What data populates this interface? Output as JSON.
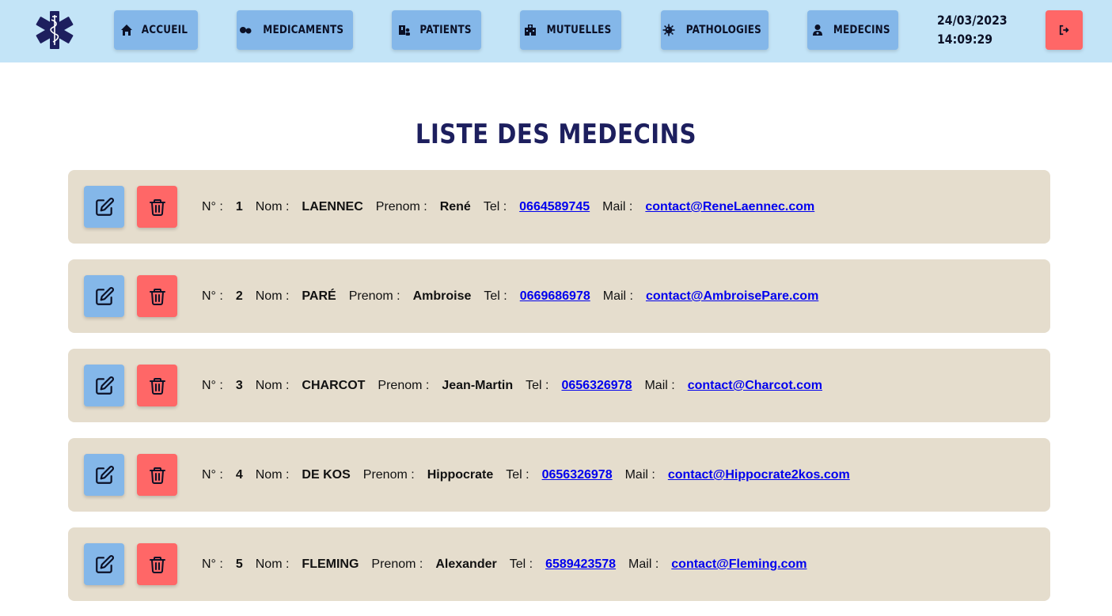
{
  "colors": {
    "topbar": "#c3e4f7",
    "nav_button": "#84b7e9",
    "danger": "#ff6767",
    "row_bg": "#e5ddcd",
    "title": "#1d1f5e",
    "link": "#0000ee"
  },
  "header": {
    "logo_icon": "star-of-life-caduceus-icon",
    "nav": [
      {
        "label": "ACCUEIL",
        "icon": "home-icon"
      },
      {
        "label": "MEDICAMENTS",
        "icon": "pills-icon"
      },
      {
        "label": "PATIENTS",
        "icon": "hospital-user-icon"
      },
      {
        "label": "MUTUELLES",
        "icon": "hospital-icon"
      },
      {
        "label": "PATHOLOGIES",
        "icon": "virus-icon"
      },
      {
        "label": "MEDECINS",
        "icon": "user-doctor-icon"
      }
    ],
    "date": "24/03/2023",
    "time": "14:09:29",
    "logout_icon": "sign-out-icon"
  },
  "main": {
    "title": "LISTE DES MEDECINS",
    "labels": {
      "num": "N° :",
      "nom": "Nom :",
      "prenom": "Prenom :",
      "tel": "Tel :",
      "mail": "Mail :"
    },
    "doctors": [
      {
        "num": "1",
        "nom": "LAENNEC",
        "prenom": "René",
        "tel": "0664589745",
        "mail": "contact@ReneLaennec.com"
      },
      {
        "num": "2",
        "nom": "PARÉ",
        "prenom": "Ambroise",
        "tel": "0669686978",
        "mail": "contact@AmbroisePare.com"
      },
      {
        "num": "3",
        "nom": "CHARCOT",
        "prenom": "Jean-Martin",
        "tel": "0656326978",
        "mail": "contact@Charcot.com"
      },
      {
        "num": "4",
        "nom": "DE KOS",
        "prenom": "Hippocrate",
        "tel": "0656326978",
        "mail": "contact@Hippocrate2kos.com"
      },
      {
        "num": "5",
        "nom": "FLEMING",
        "prenom": "Alexander",
        "tel": "6589423578",
        "mail": "contact@Fleming.com"
      }
    ]
  }
}
